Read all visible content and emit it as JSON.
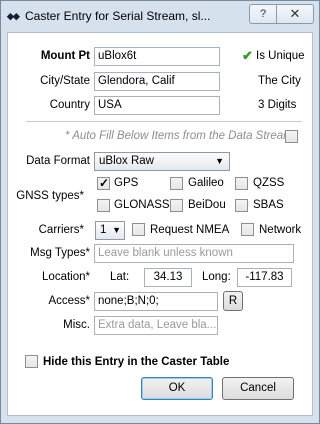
{
  "window": {
    "title": "Caster Entry for Serial Stream, sl...",
    "help_glyph": "?",
    "close_glyph": "✕"
  },
  "mount": {
    "label": "Mount Pt",
    "value": "uBlox6t",
    "status": "Is Unique",
    "status_icon": "check-icon"
  },
  "city": {
    "label": "City/State",
    "value": "Glendora, Calif",
    "hint": "The City"
  },
  "country": {
    "label": "Country",
    "value": "USA",
    "hint": "3 Digits"
  },
  "autofill": {
    "label": "* Auto Fill Below Items from the Data Stream"
  },
  "data_format": {
    "label": "Data Format",
    "selected": "uBlox Raw"
  },
  "gnss": {
    "label": "GNSS types*",
    "options": [
      {
        "label": "GPS",
        "checked": true
      },
      {
        "label": "Galileo",
        "checked": false
      },
      {
        "label": "QZSS",
        "checked": false
      },
      {
        "label": "GLONASS",
        "checked": false
      },
      {
        "label": "BeiDou",
        "checked": false
      },
      {
        "label": "SBAS",
        "checked": false
      }
    ]
  },
  "carriers": {
    "label": "Carriers*",
    "selected": "1",
    "request_nmea": "Request NMEA",
    "network": "Network"
  },
  "msg_types": {
    "label": "Msg Types*",
    "placeholder": "Leave blank unless known"
  },
  "location": {
    "label": "Location*",
    "lat_label": "Lat:",
    "lat": "34.13",
    "long_label": "Long:",
    "long": "-117.83"
  },
  "access": {
    "label": "Access*",
    "value": "none;B;N;0;",
    "button": "R"
  },
  "misc": {
    "label": "Misc.",
    "placeholder": "Extra data, Leave bla..."
  },
  "hide_entry": {
    "label": "Hide this Entry in the Caster Table"
  },
  "buttons": {
    "ok": "OK",
    "cancel": "Cancel"
  }
}
